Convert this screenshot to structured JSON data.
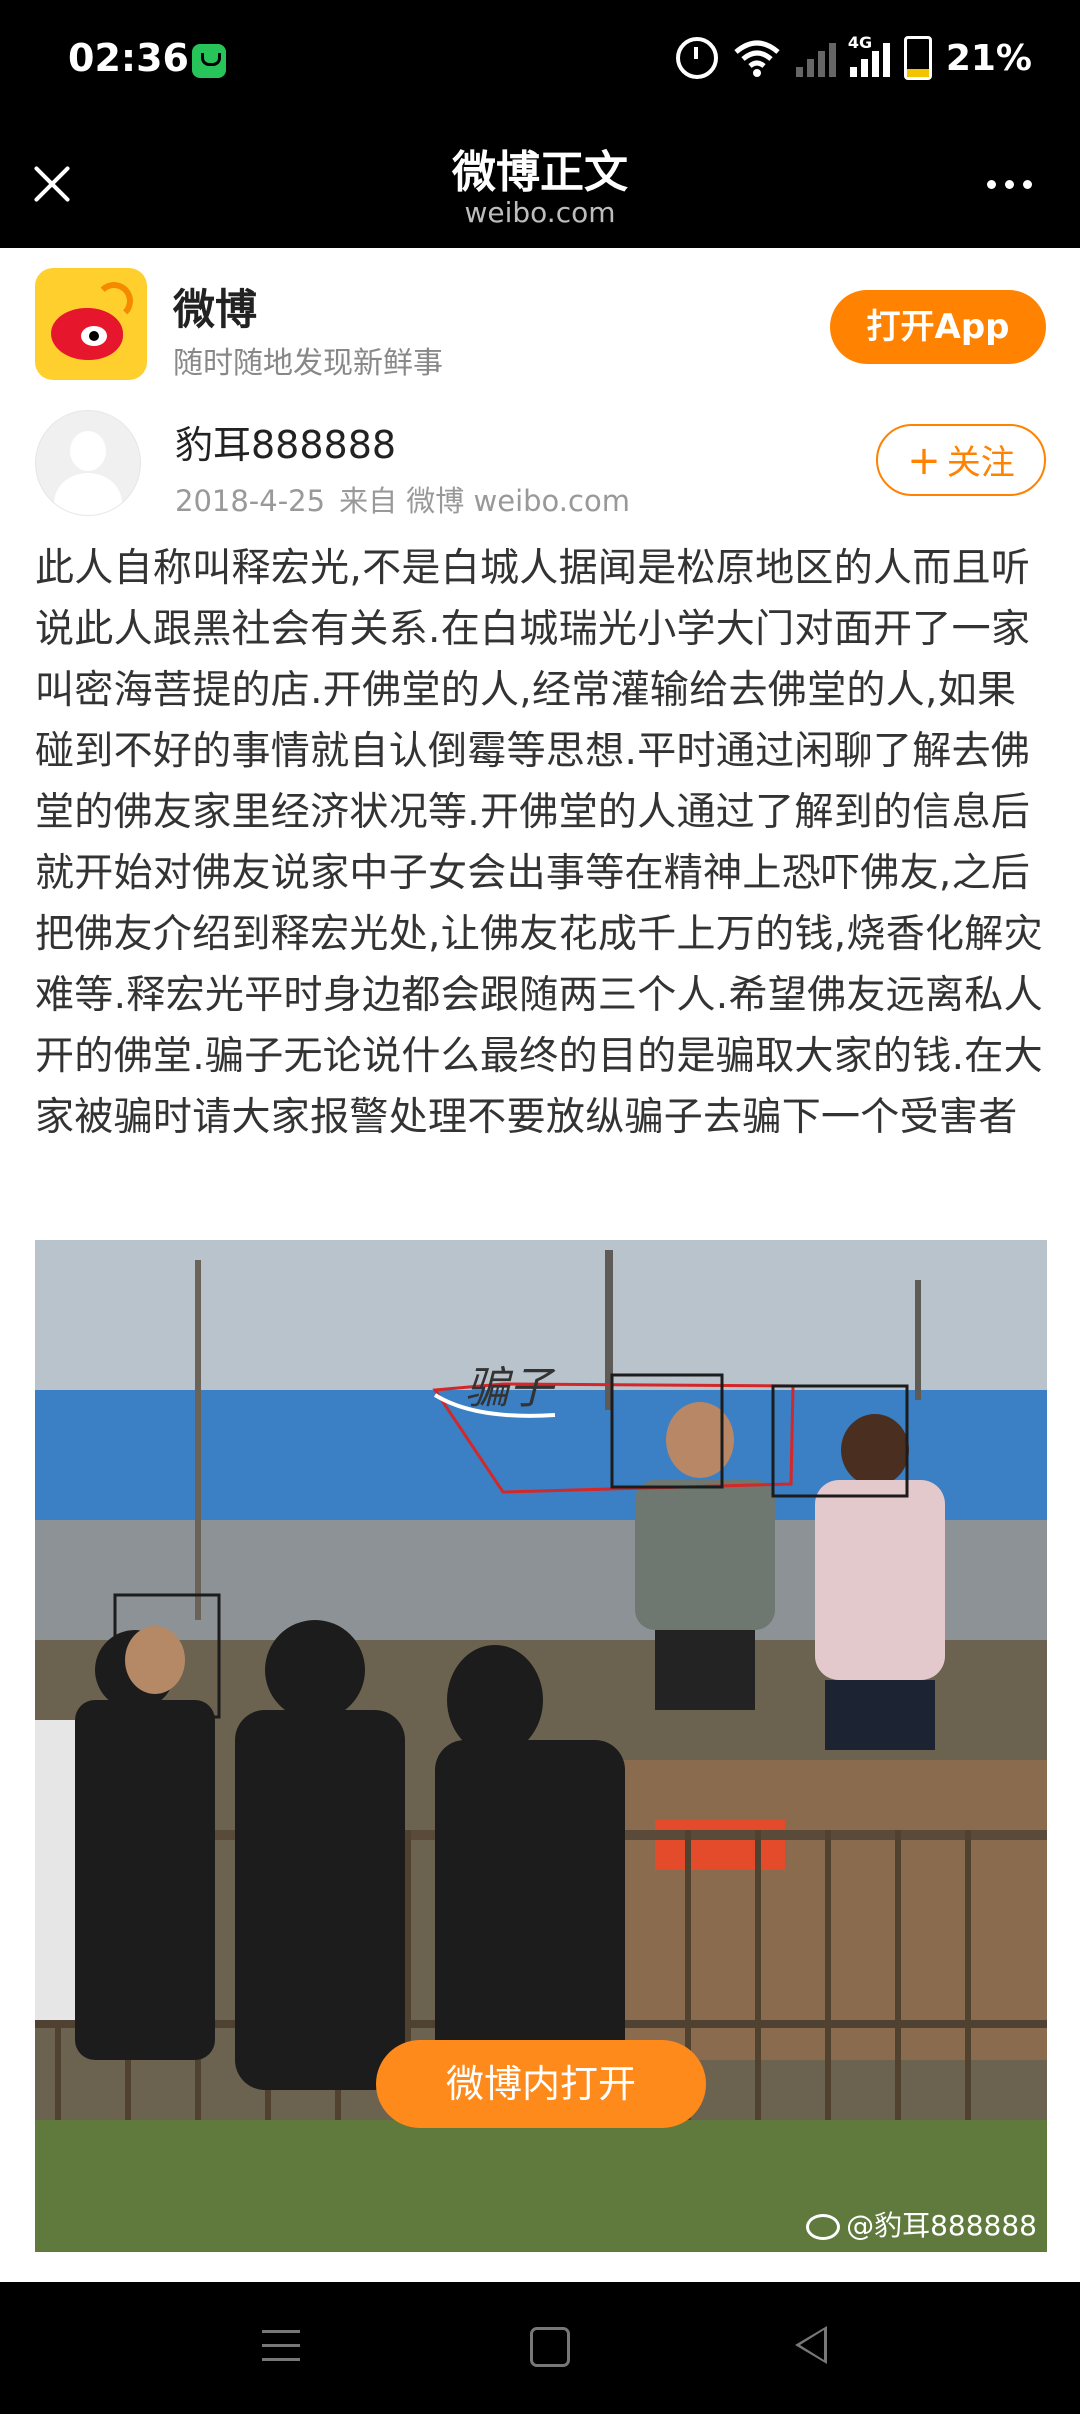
{
  "status_bar": {
    "time": "02:36",
    "network": "4G",
    "battery_percent": "21%"
  },
  "title_bar": {
    "title": "微博正文",
    "subtitle": "weibo.com"
  },
  "app_banner": {
    "name": "微博",
    "slogan": "随时随地发现新鲜事",
    "open_app_label": "打开App"
  },
  "author": {
    "username": "豹耳888888",
    "date": "2018-4-25",
    "source": "来自 微博 weibo.com",
    "follow_label": "关注"
  },
  "post": {
    "text": "此人自称叫释宏光,不是白城人据闻是松原地区的人而且听说此人跟黑社会有关系.在白城瑞光小学大门对面开了一家叫密海菩提的店.开佛堂的人,经常灌输给去佛堂的人,如果碰到不好的事情就自认倒霉等思想.平时通过闲聊了解去佛堂的佛友家里经济状况等.开佛堂的人通过了解到的信息后就开始对佛友说家中子女会出事等在精神上恐吓佛友,之后把佛友介绍到释宏光处,让佛友花成千上万的钱,烧香化解灾难等.释宏光平时身边都会跟随两三个人.希望佛友远离私人开的佛堂.骗子无论说什么最终的目的是骗取大家的钱.在大家被骗时请大家报警处理不要放纵骗子去骗下一个受害者",
    "image": {
      "handwritten_label": "骗子",
      "watermark": "@豹耳888888",
      "open_in_weibo_label": "微博内打开"
    }
  },
  "colors": {
    "accent": "#ff8200",
    "bar_bg": "#000000",
    "text": "#333333",
    "meta": "#999999"
  }
}
